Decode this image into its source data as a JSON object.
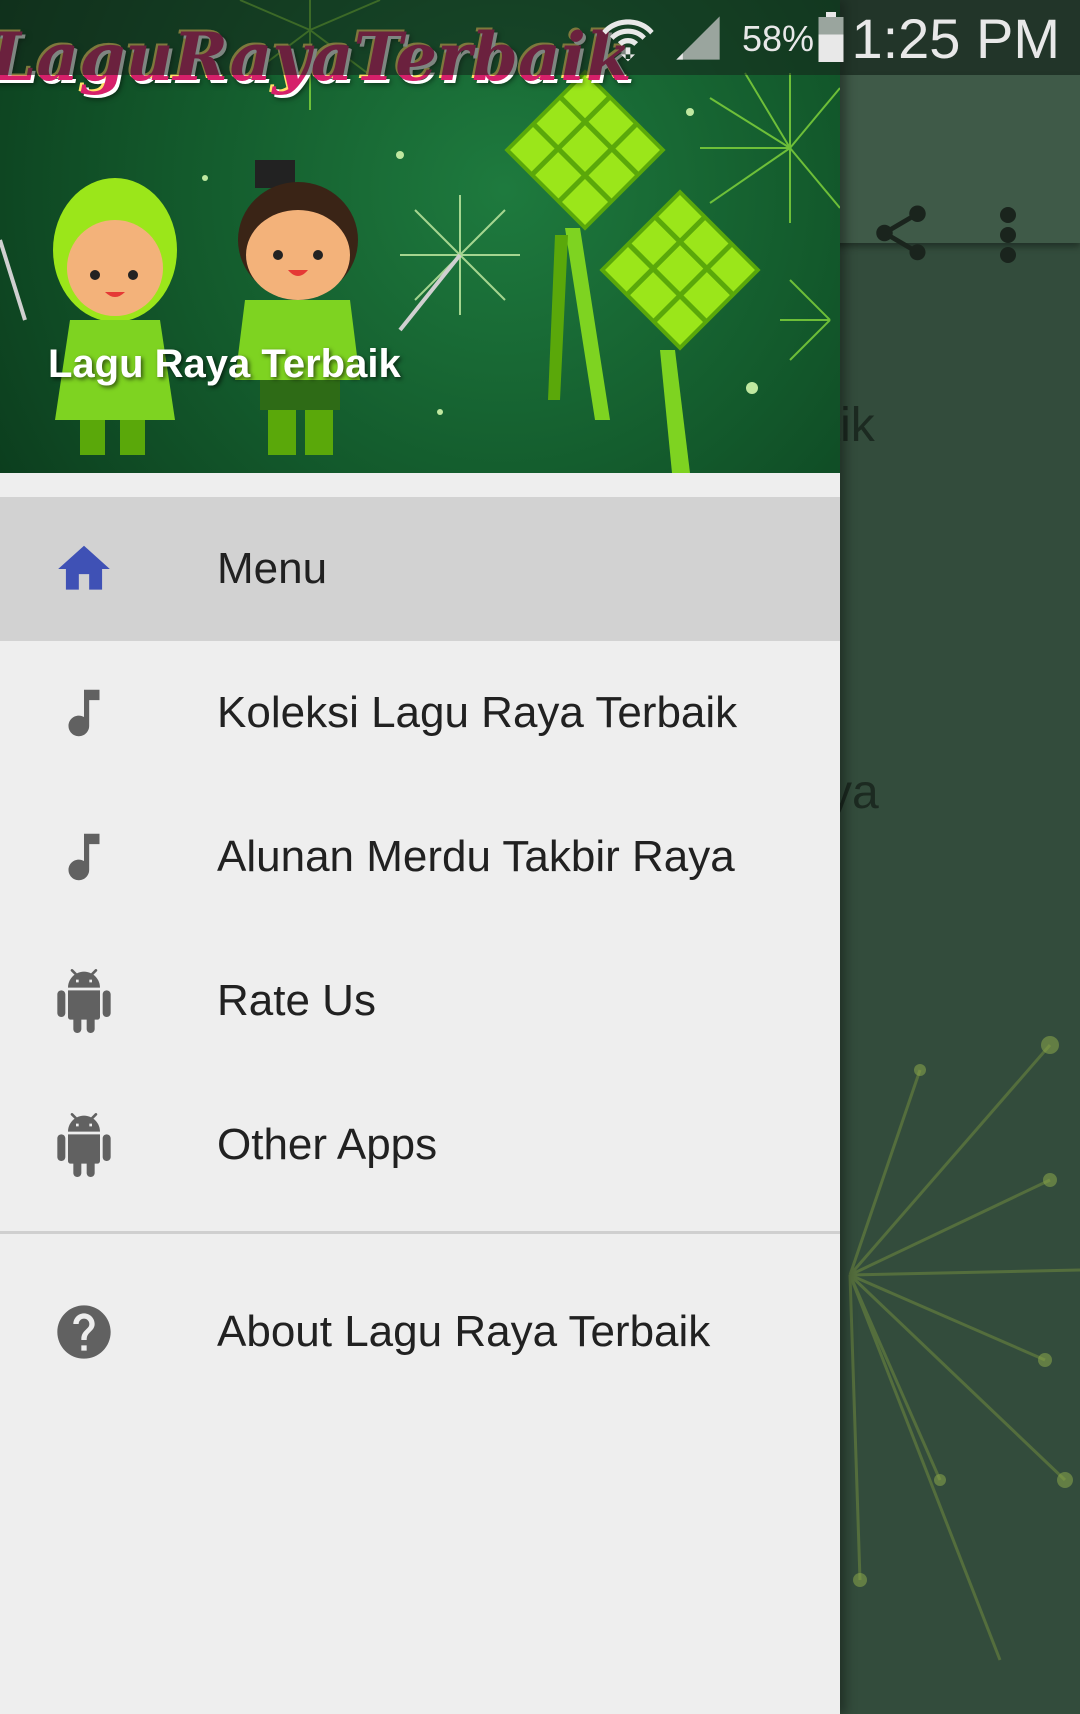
{
  "status_bar": {
    "time": "1:25 PM",
    "battery_percent": "58%",
    "icons": [
      "wifi-icon",
      "signal-icon",
      "battery-icon"
    ]
  },
  "background_app": {
    "visible_items": [
      "Terbaik",
      "bir Raya"
    ],
    "toolbar_icons": [
      "share-icon",
      "more-vert-icon"
    ]
  },
  "drawer": {
    "header": {
      "logo_text": "LaguRayaTerbaik",
      "title": "Lagu Raya Terbaik"
    },
    "items": [
      {
        "label": "Menu",
        "icon": "home-icon",
        "active": true
      },
      {
        "label": "Koleksi Lagu Raya Terbaik",
        "icon": "music-note-icon",
        "active": false
      },
      {
        "label": "Alunan Merdu Takbir Raya",
        "icon": "music-note-icon",
        "active": false
      },
      {
        "label": "Rate Us",
        "icon": "android-icon",
        "active": false
      },
      {
        "label": "Other Apps",
        "icon": "android-icon",
        "active": false
      }
    ],
    "footer_items": [
      {
        "label": "About Lagu Raya Terbaik",
        "icon": "help-icon"
      }
    ]
  },
  "colors": {
    "accent": "#3f51b5",
    "icon_gray": "#616161",
    "drawer_bg": "#eeeeee",
    "active_bg": "#d2d2d2",
    "header_green": "#135a2c"
  }
}
